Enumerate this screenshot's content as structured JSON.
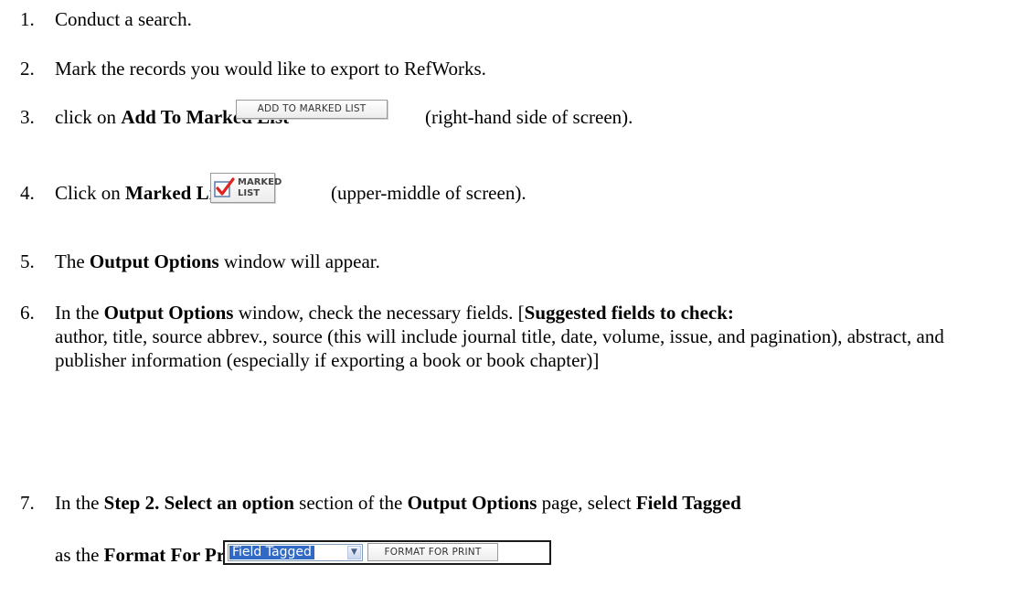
{
  "steps": [
    {
      "num": "1.",
      "text": "Conduct a search."
    },
    {
      "num": "2.",
      "text": "Mark the records you would like to export to RefWorks."
    },
    {
      "num": "3.",
      "pre": "click on ",
      "bold": "Add To Marked List",
      "post": "(right-hand side of screen)."
    },
    {
      "num": "4.",
      "pre": "Click on ",
      "bold": "Marked List",
      "post": "(upper-middle of screen)."
    },
    {
      "num": "5.",
      "pre": "The ",
      "bold": "Output Options",
      "post": " window will appear."
    },
    {
      "num": "6.",
      "pre": "In the ",
      "bold": "Output Options",
      "mid": " window, check the necessary fields.  [",
      "bold2": "Suggested fields to check:",
      "post": " author, title, source abbrev., source (this will include journal title, date, volume, issue, and pagination), abstract, and publisher information (especially if exporting a book or book chapter)]"
    },
    {
      "num": "7.",
      "pre": "In the ",
      "bold": "Step 2. Select an option",
      "mid": " section of the ",
      "bold2": "Output Options",
      "mid2": " page, select ",
      "bold3": "Field Tagged",
      "line2_pre": "as the ",
      "line2_bold": "Format For Print."
    }
  ],
  "buttons": {
    "add_to_marked_list": "ADD TO MARKED LIST",
    "marked_line1": "MARKED",
    "marked_line2": "LIST",
    "format_for_print": "FORMAT FOR PRINT"
  },
  "select": {
    "value": "Field Tagged"
  },
  "icons": {
    "checkmark": "checkmark-icon",
    "dropdown": "chevron-down-icon"
  },
  "colors": {
    "checkmark_red": "#e0231e",
    "selection_blue": "#316ac5"
  }
}
